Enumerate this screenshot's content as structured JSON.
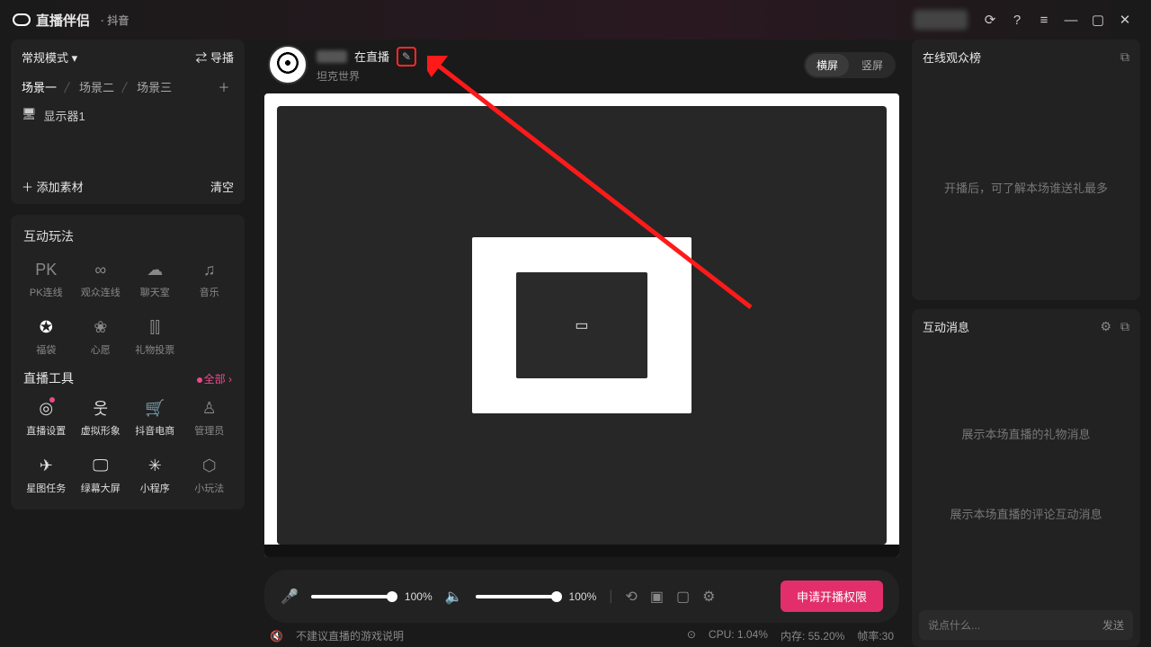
{
  "title": "直播伴侣",
  "title_sub": "· 抖音",
  "mode": "常规模式",
  "guide": "导播",
  "scenes": [
    "场景一",
    "场景二",
    "场景三"
  ],
  "monitor": "显示器1",
  "add_material": "添加素材",
  "clear": "清空",
  "interact_title": "互动玩法",
  "interact_items": [
    "PK连线",
    "观众连线",
    "聊天室",
    "音乐",
    "福袋",
    "心愿",
    "礼物投票"
  ],
  "tools_title": "直播工具",
  "tools_all": "全部",
  "tools_items": [
    "直播设置",
    "虚拟形象",
    "抖音电商",
    "管理员",
    "星图任务",
    "绿幕大屏",
    "小程序",
    "小玩法"
  ],
  "user_status": "在直播",
  "game": "坦克世界",
  "orient_h": "横屏",
  "orient_v": "竖屏",
  "vol_mic": "100%",
  "vol_spk": "100%",
  "apply_btn": "申请开播权限",
  "warning": "不建议直播的游戏说明",
  "cpu": "CPU: 1.04%",
  "mem": "内存: 55.20%",
  "fps": "帧率:30",
  "viewers_title": "在线观众榜",
  "viewers_empty": "开播后，可了解本场谁送礼最多",
  "msg_title": "互动消息",
  "msg_gift": "展示本场直播的礼物消息",
  "msg_comment": "展示本场直播的评论互动消息",
  "chat_placeholder": "说点什么...",
  "chat_send": "发送"
}
